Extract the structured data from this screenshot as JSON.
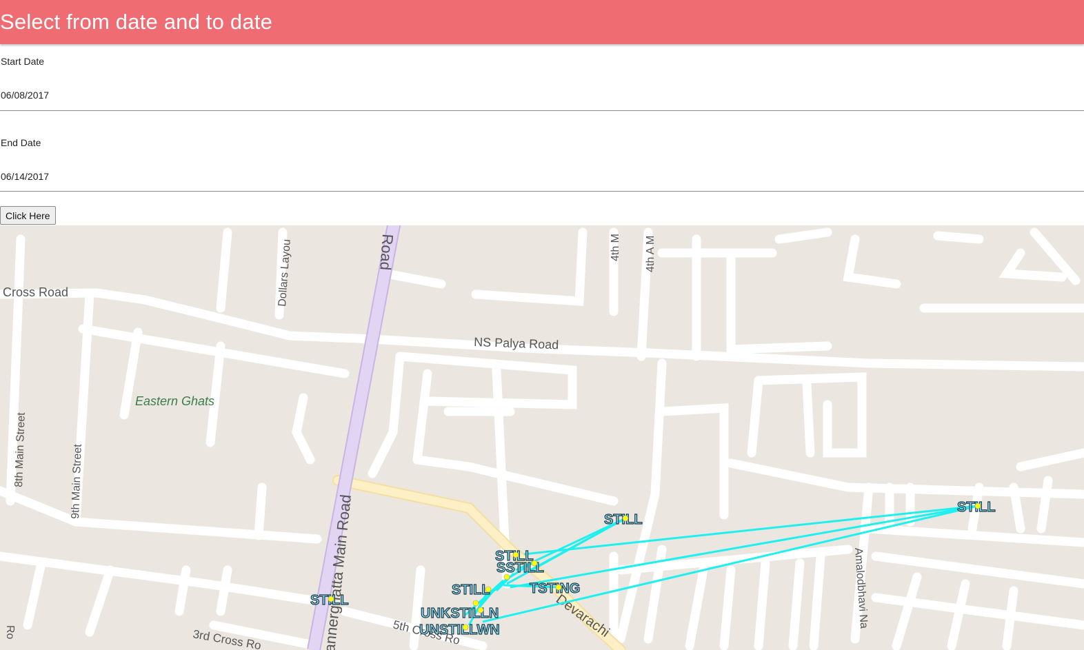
{
  "header": {
    "title": "Select from date and to date"
  },
  "form": {
    "start_label": "Start Date",
    "start_value": "06/08/2017",
    "end_label": "End Date",
    "end_value": "06/14/2017",
    "button_label": "Click Here"
  },
  "map": {
    "street_labels": {
      "cross_road": "Cross Road",
      "road_top": "Road",
      "dollars_layout": "Dollars Layou",
      "fourth_m": "4th M",
      "fourth_a_m": "4th A M",
      "ns_palya": "NS Palya Road",
      "eastern_ghats": "Eastern Ghats",
      "eighth_main": "8th Main Street",
      "ninth_main": "9th Main Street",
      "bannerghatta": "annerghatta Main Road",
      "third_cross": "3rd Cross Ro",
      "fifth_cross": "5th Cross Ro",
      "devarachi": "Devarachi",
      "amalodbhavi": "Amalodbhavi Na",
      "ro_left": "Ro"
    },
    "markers": [
      {
        "label": "STILL"
      },
      {
        "label": "STILL"
      },
      {
        "label": "STILL"
      },
      {
        "label": "STILL"
      },
      {
        "label": "TSTING"
      },
      {
        "label": "SSTILL"
      },
      {
        "label": "UNKSTILLN"
      },
      {
        "label": "UNSTILLWN"
      },
      {
        "label": "STILL"
      }
    ],
    "colors": {
      "track": "#1ef0f0",
      "marker": "#ffff00",
      "main_road": "#e2d4f3",
      "secondary_road": "#fdeebf",
      "land": "#ebe7e0",
      "park_label": "#3a7d4a"
    }
  }
}
